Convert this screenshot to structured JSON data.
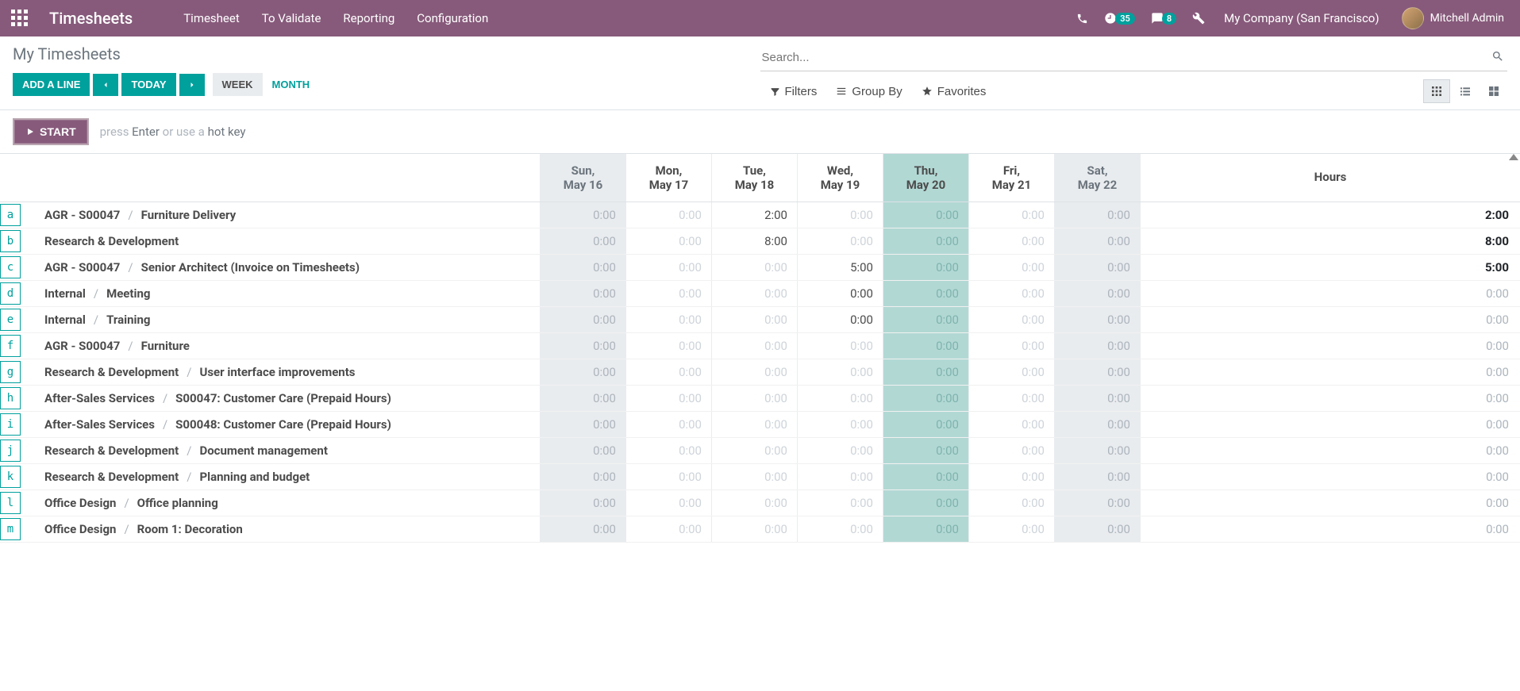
{
  "topbar": {
    "brand": "Timesheets",
    "nav": [
      "Timesheet",
      "To Validate",
      "Reporting",
      "Configuration"
    ],
    "activity_count": "35",
    "message_count": "8",
    "company": "My Company (San Francisco)",
    "user": "Mitchell Admin"
  },
  "header": {
    "title": "My Timesheets",
    "add_line": "ADD A LINE",
    "today": "TODAY",
    "period_week": "WEEK",
    "period_month": "MONTH",
    "search_placeholder": "Search...",
    "filters": "Filters",
    "group_by": "Group By",
    "favorites": "Favorites"
  },
  "startbar": {
    "start": "START",
    "hint_press": "press ",
    "hint_enter": "Enter",
    "hint_or": " or use a ",
    "hint_hotkey": "hot key"
  },
  "days": [
    {
      "top": "Sun,",
      "bottom": "May 16",
      "type": "muted"
    },
    {
      "top": "Mon,",
      "bottom": "May 17",
      "type": "normal"
    },
    {
      "top": "Tue,",
      "bottom": "May 18",
      "type": "normal"
    },
    {
      "top": "Wed,",
      "bottom": "May 19",
      "type": "normal"
    },
    {
      "top": "Thu,",
      "bottom": "May 20",
      "type": "today"
    },
    {
      "top": "Fri,",
      "bottom": "May 21",
      "type": "normal"
    },
    {
      "top": "Sat,",
      "bottom": "May 22",
      "type": "muted"
    }
  ],
  "total_header": "Hours",
  "rows": [
    {
      "key": "a",
      "project": "AGR - S00047",
      "task": "Furniture Delivery",
      "cells": [
        "0:00",
        "0:00",
        "2:00",
        "0:00",
        "0:00",
        "0:00",
        "0:00"
      ],
      "total": "2:00"
    },
    {
      "key": "b",
      "project": "Research & Development",
      "task": "",
      "cells": [
        "0:00",
        "0:00",
        "8:00",
        "0:00",
        "0:00",
        "0:00",
        "0:00"
      ],
      "total": "8:00"
    },
    {
      "key": "c",
      "project": "AGR - S00047",
      "task": "Senior Architect (Invoice on Timesheets)",
      "cells": [
        "0:00",
        "0:00",
        "0:00",
        "5:00",
        "0:00",
        "0:00",
        "0:00"
      ],
      "total": "5:00"
    },
    {
      "key": "d",
      "project": "Internal",
      "task": "Meeting",
      "cells": [
        "0:00",
        "0:00",
        "0:00",
        "0:00",
        "0:00",
        "0:00",
        "0:00"
      ],
      "total": "0:00",
      "wed_filled": true
    },
    {
      "key": "e",
      "project": "Internal",
      "task": "Training",
      "cells": [
        "0:00",
        "0:00",
        "0:00",
        "0:00",
        "0:00",
        "0:00",
        "0:00"
      ],
      "total": "0:00",
      "wed_filled": true
    },
    {
      "key": "f",
      "project": "AGR - S00047",
      "task": "Furniture",
      "cells": [
        "0:00",
        "0:00",
        "0:00",
        "0:00",
        "0:00",
        "0:00",
        "0:00"
      ],
      "total": "0:00"
    },
    {
      "key": "g",
      "project": "Research & Development",
      "task": "User interface improvements",
      "cells": [
        "0:00",
        "0:00",
        "0:00",
        "0:00",
        "0:00",
        "0:00",
        "0:00"
      ],
      "total": "0:00"
    },
    {
      "key": "h",
      "project": "After-Sales Services",
      "task": "S00047: Customer Care (Prepaid Hours)",
      "cells": [
        "0:00",
        "0:00",
        "0:00",
        "0:00",
        "0:00",
        "0:00",
        "0:00"
      ],
      "total": "0:00"
    },
    {
      "key": "i",
      "project": "After-Sales Services",
      "task": "S00048: Customer Care (Prepaid Hours)",
      "cells": [
        "0:00",
        "0:00",
        "0:00",
        "0:00",
        "0:00",
        "0:00",
        "0:00"
      ],
      "total": "0:00"
    },
    {
      "key": "j",
      "project": "Research & Development",
      "task": "Document management",
      "cells": [
        "0:00",
        "0:00",
        "0:00",
        "0:00",
        "0:00",
        "0:00",
        "0:00"
      ],
      "total": "0:00"
    },
    {
      "key": "k",
      "project": "Research & Development",
      "task": "Planning and budget",
      "cells": [
        "0:00",
        "0:00",
        "0:00",
        "0:00",
        "0:00",
        "0:00",
        "0:00"
      ],
      "total": "0:00"
    },
    {
      "key": "l",
      "project": "Office Design",
      "task": "Office planning",
      "cells": [
        "0:00",
        "0:00",
        "0:00",
        "0:00",
        "0:00",
        "0:00",
        "0:00"
      ],
      "total": "0:00"
    },
    {
      "key": "m",
      "project": "Office Design",
      "task": "Room 1: Decoration",
      "cells": [
        "0:00",
        "0:00",
        "0:00",
        "0:00",
        "0:00",
        "0:00",
        "0:00"
      ],
      "total": "0:00"
    }
  ]
}
